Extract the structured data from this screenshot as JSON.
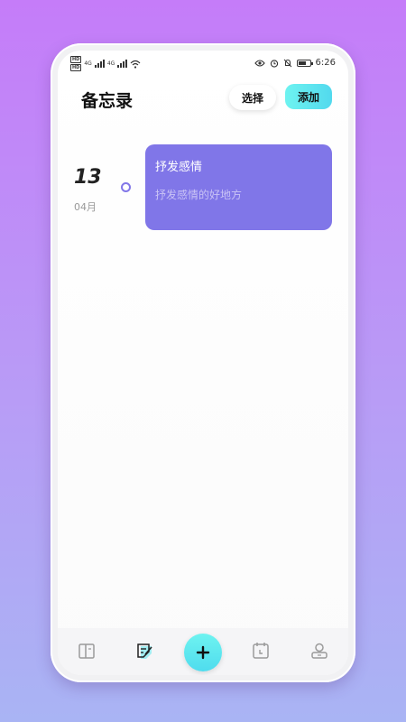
{
  "status_bar": {
    "sim1": "HD",
    "sim2": "HD",
    "signal1": "4G",
    "signal2": "4G",
    "time": "6:26"
  },
  "header": {
    "title": "备忘录",
    "select_label": "选择",
    "add_label": "添加"
  },
  "memo": {
    "day": "13",
    "month": "04月",
    "title": "抒发感情",
    "body": "抒发感情的好地方"
  },
  "colors": {
    "accent": "#8076e8",
    "cyan": "#5ee6ef"
  },
  "tabbar": {
    "icons": [
      "book-icon",
      "edit-note-icon",
      "plus-icon",
      "calendar-icon",
      "user-icon"
    ]
  }
}
